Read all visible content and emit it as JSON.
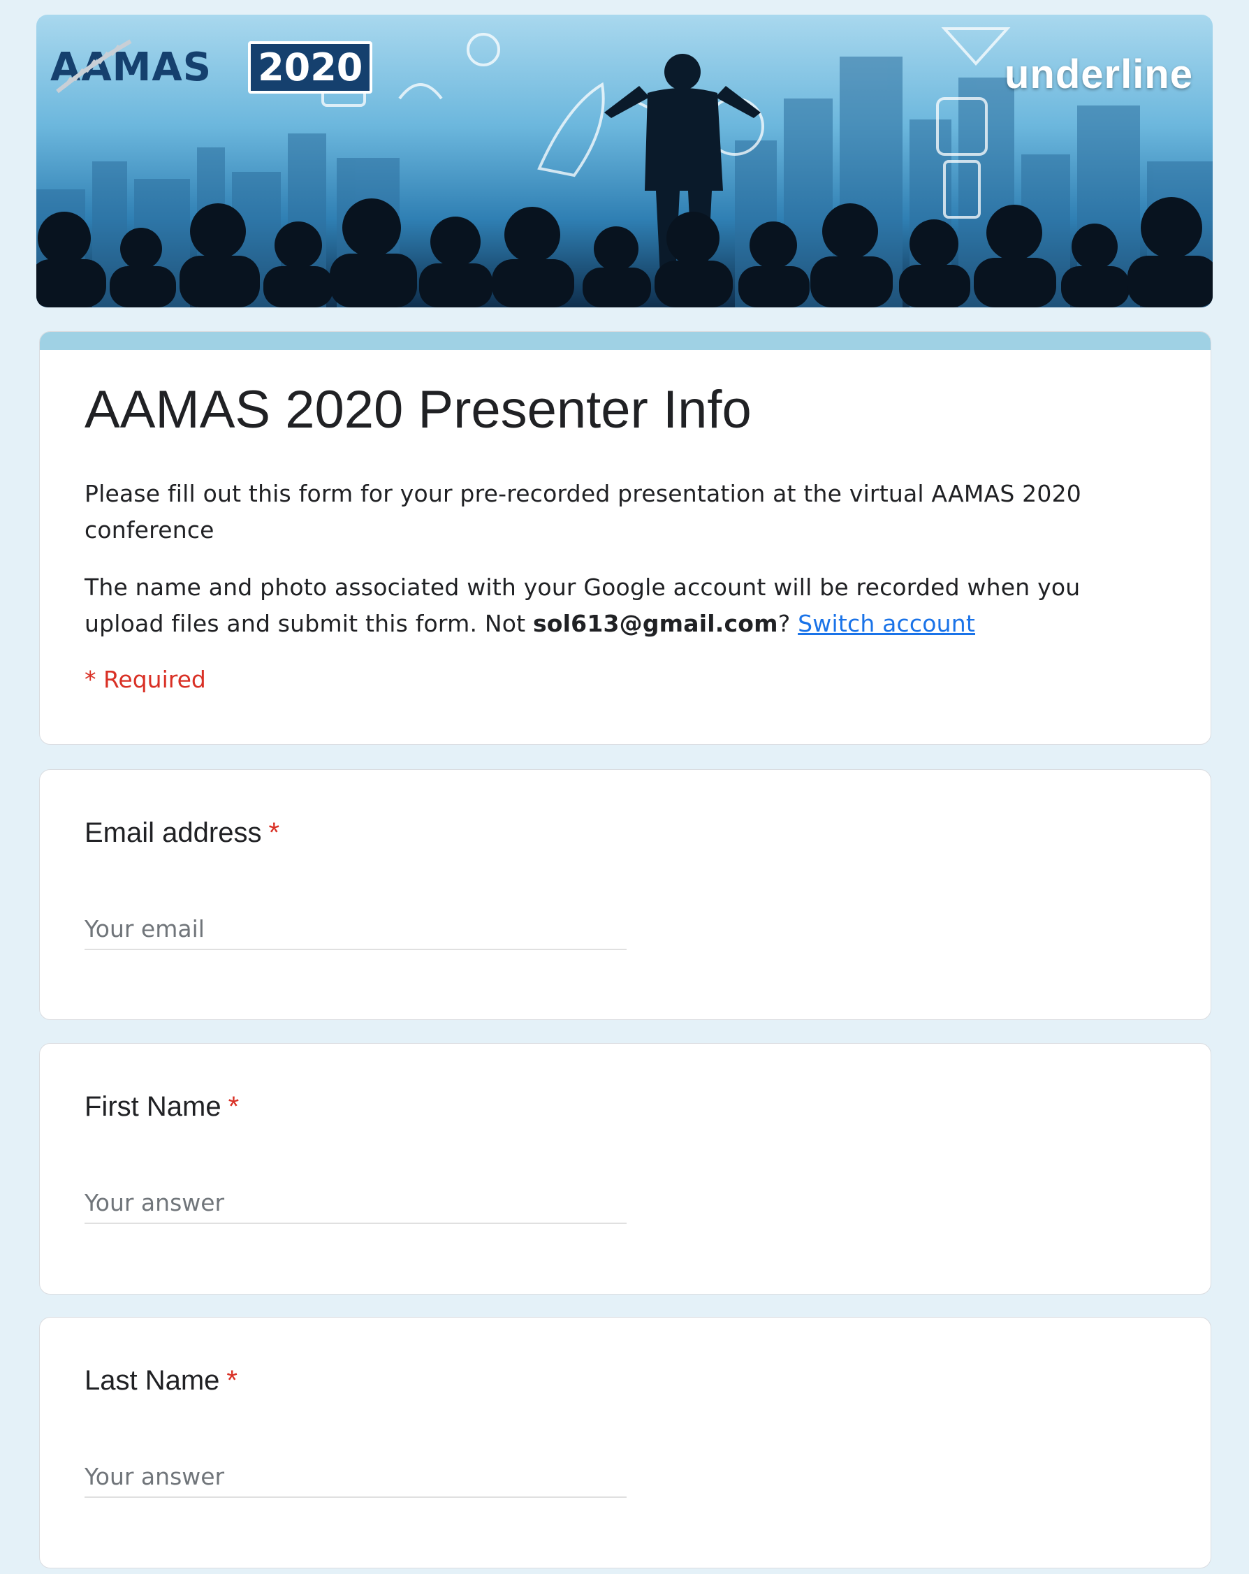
{
  "banner": {
    "logo_word": "AAMAS",
    "logo_year": "2020",
    "right_logo": "underline"
  },
  "header": {
    "title": "AAMAS 2020 Presenter Info",
    "description": "Please fill out this form for your pre-recorded presentation at the virtual AAMAS 2020 conference",
    "account_notice_prefix": "The name and photo associated with your Google account will be recorded when you upload files and submit this form. Not ",
    "account_email": "sol613@gmail.com",
    "account_notice_suffix": "?",
    "switch_account": "Switch account",
    "required_note": "* Required"
  },
  "questions": [
    {
      "label": "Email address",
      "required_mark": "*",
      "placeholder": "Your email"
    },
    {
      "label": "First Name",
      "required_mark": "*",
      "placeholder": "Your answer"
    },
    {
      "label": "Last Name",
      "required_mark": "*",
      "placeholder": "Your answer"
    }
  ],
  "colors": {
    "background": "#e4f1f8",
    "accent": "#9fd1e4",
    "required": "#d93025",
    "link": "#1a73e8"
  }
}
